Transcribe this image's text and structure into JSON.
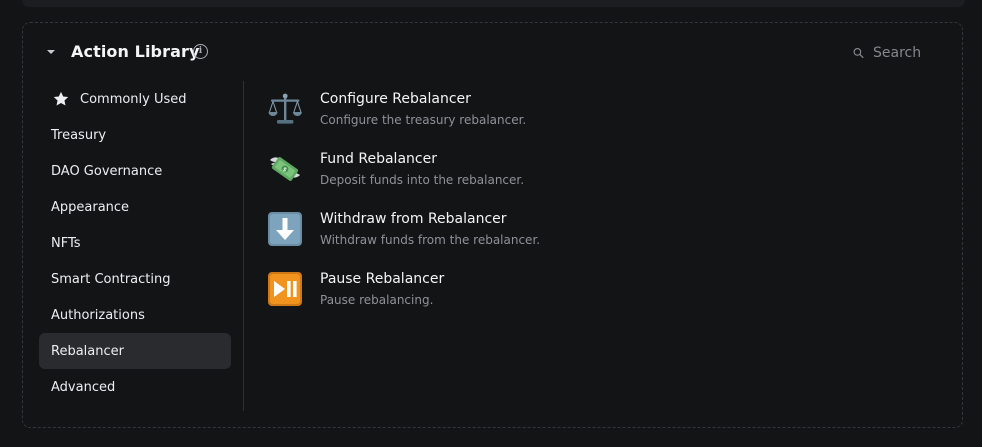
{
  "header": {
    "title": "Action Library",
    "info_icon": "info-icon",
    "collapse_icon": "caret-down-icon"
  },
  "search": {
    "placeholder": "Search",
    "icon": "search-icon"
  },
  "sidebar": {
    "items": [
      {
        "label": "Commonly Used",
        "icon": "star-icon",
        "selected": false
      },
      {
        "label": "Treasury",
        "selected": false
      },
      {
        "label": "DAO Governance",
        "selected": false
      },
      {
        "label": "Appearance",
        "selected": false
      },
      {
        "label": "NFTs",
        "selected": false
      },
      {
        "label": "Smart Contracting",
        "selected": false
      },
      {
        "label": "Authorizations",
        "selected": false
      },
      {
        "label": "Rebalancer",
        "selected": true
      },
      {
        "label": "Advanced",
        "selected": false
      }
    ]
  },
  "actions": [
    {
      "title": "Configure Rebalancer",
      "description": "Configure the treasury rebalancer.",
      "icon": "balance-scale-icon"
    },
    {
      "title": "Fund Rebalancer",
      "description": "Deposit funds into the rebalancer.",
      "icon": "money-with-wings-icon"
    },
    {
      "title": "Withdraw from Rebalancer",
      "description": "Withdraw funds from the rebalancer.",
      "icon": "down-arrow-icon"
    },
    {
      "title": "Pause Rebalancer",
      "description": "Pause rebalancing.",
      "icon": "play-pause-icon"
    }
  ],
  "colors": {
    "background": "#131416",
    "selected_item": "#2a2b2e",
    "text_primary": "#f3f5f7",
    "text_secondary": "#8e9198"
  }
}
